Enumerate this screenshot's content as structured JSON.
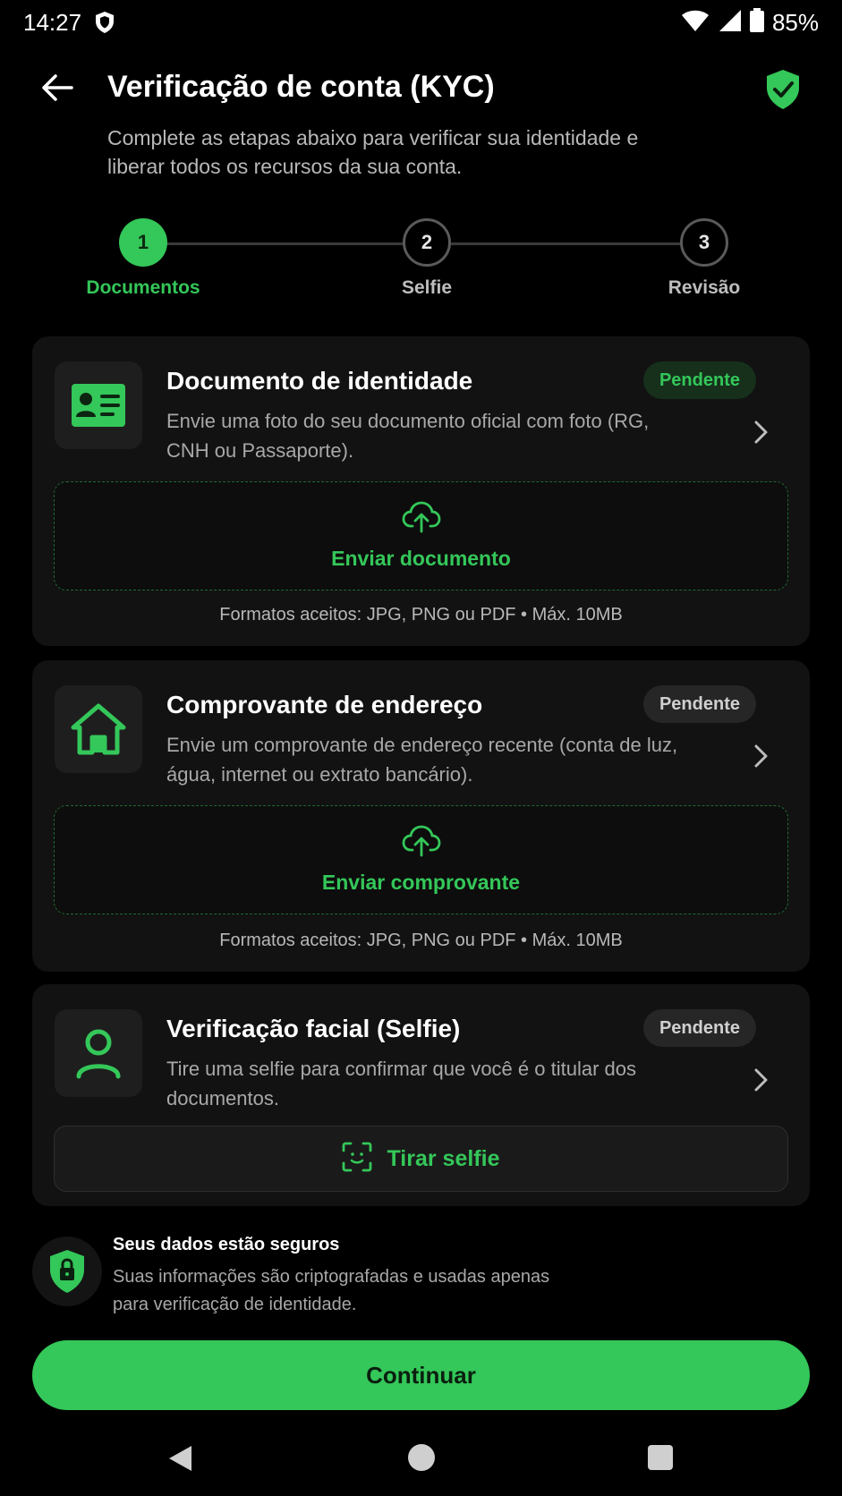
{
  "status_bar": {
    "time": "14:27",
    "battery": "85%",
    "icons": [
      "shield-status-icon",
      "wifi-icon",
      "signal-icon",
      "battery-icon"
    ]
  },
  "header": {
    "title": "Verificação de conta (KYC)",
    "subtitle": "Complete as etapas abaixo para verificar sua identidade e liberar todos os recursos da sua conta.",
    "back_icon": "arrow-left-icon",
    "status_icon": "shield-check-icon"
  },
  "stepper": {
    "steps": [
      {
        "number": "1",
        "label": "Documentos",
        "state": "active"
      },
      {
        "number": "2",
        "label": "Selfie",
        "state": "inactive"
      },
      {
        "number": "3",
        "label": "Revisão",
        "state": "inactive"
      }
    ]
  },
  "cards": {
    "identity": {
      "title": "Documento de identidade",
      "description": "Envie uma foto do seu documento oficial com foto (RG, CNH ou Passaporte).",
      "badge": "Pendente",
      "upload_label": "Enviar documento",
      "formats": "Formatos aceitos: JPG, PNG ou PDF • Máx. 10MB",
      "icon": "id-card-icon"
    },
    "address": {
      "title": "Comprovante de endereço",
      "description": "Envie um comprovante de endereço recente (conta de luz, água, internet ou extrato bancário).",
      "badge": "Pendente",
      "upload_label": "Enviar comprovante",
      "formats": "Formatos aceitos: JPG, PNG ou PDF • Máx. 10MB",
      "icon": "house-icon"
    },
    "selfie": {
      "title": "Verificação facial (Selfie)",
      "description": "Tire uma selfie para confirmar que você é o titular dos documentos.",
      "badge": "Pendente",
      "button_label": "Tirar selfie",
      "icon": "user-icon"
    }
  },
  "security": {
    "title": "Seus dados estão seguros",
    "description": "Suas informações são criptografadas e usadas apenas para verificação de identidade.",
    "icon": "shield-lock-icon"
  },
  "continue_button": {
    "label": "Continuar"
  },
  "colors": {
    "accent": "#34c759",
    "background": "#000000",
    "card": "#121212",
    "muted_text": "#a8a8a8"
  }
}
